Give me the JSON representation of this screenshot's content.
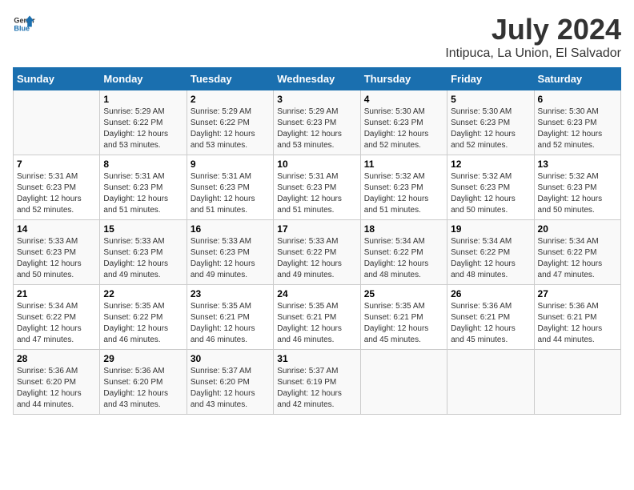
{
  "logo": {
    "general": "General",
    "blue": "Blue"
  },
  "title": "July 2024",
  "subtitle": "Intipuca, La Union, El Salvador",
  "days_header": [
    "Sunday",
    "Monday",
    "Tuesday",
    "Wednesday",
    "Thursday",
    "Friday",
    "Saturday"
  ],
  "weeks": [
    [
      {
        "day": "",
        "info": ""
      },
      {
        "day": "1",
        "info": "Sunrise: 5:29 AM\nSunset: 6:22 PM\nDaylight: 12 hours\nand 53 minutes."
      },
      {
        "day": "2",
        "info": "Sunrise: 5:29 AM\nSunset: 6:22 PM\nDaylight: 12 hours\nand 53 minutes."
      },
      {
        "day": "3",
        "info": "Sunrise: 5:29 AM\nSunset: 6:23 PM\nDaylight: 12 hours\nand 53 minutes."
      },
      {
        "day": "4",
        "info": "Sunrise: 5:30 AM\nSunset: 6:23 PM\nDaylight: 12 hours\nand 52 minutes."
      },
      {
        "day": "5",
        "info": "Sunrise: 5:30 AM\nSunset: 6:23 PM\nDaylight: 12 hours\nand 52 minutes."
      },
      {
        "day": "6",
        "info": "Sunrise: 5:30 AM\nSunset: 6:23 PM\nDaylight: 12 hours\nand 52 minutes."
      }
    ],
    [
      {
        "day": "7",
        "info": "Sunrise: 5:31 AM\nSunset: 6:23 PM\nDaylight: 12 hours\nand 52 minutes."
      },
      {
        "day": "8",
        "info": "Sunrise: 5:31 AM\nSunset: 6:23 PM\nDaylight: 12 hours\nand 51 minutes."
      },
      {
        "day": "9",
        "info": "Sunrise: 5:31 AM\nSunset: 6:23 PM\nDaylight: 12 hours\nand 51 minutes."
      },
      {
        "day": "10",
        "info": "Sunrise: 5:31 AM\nSunset: 6:23 PM\nDaylight: 12 hours\nand 51 minutes."
      },
      {
        "day": "11",
        "info": "Sunrise: 5:32 AM\nSunset: 6:23 PM\nDaylight: 12 hours\nand 51 minutes."
      },
      {
        "day": "12",
        "info": "Sunrise: 5:32 AM\nSunset: 6:23 PM\nDaylight: 12 hours\nand 50 minutes."
      },
      {
        "day": "13",
        "info": "Sunrise: 5:32 AM\nSunset: 6:23 PM\nDaylight: 12 hours\nand 50 minutes."
      }
    ],
    [
      {
        "day": "14",
        "info": "Sunrise: 5:33 AM\nSunset: 6:23 PM\nDaylight: 12 hours\nand 50 minutes."
      },
      {
        "day": "15",
        "info": "Sunrise: 5:33 AM\nSunset: 6:23 PM\nDaylight: 12 hours\nand 49 minutes."
      },
      {
        "day": "16",
        "info": "Sunrise: 5:33 AM\nSunset: 6:23 PM\nDaylight: 12 hours\nand 49 minutes."
      },
      {
        "day": "17",
        "info": "Sunrise: 5:33 AM\nSunset: 6:22 PM\nDaylight: 12 hours\nand 49 minutes."
      },
      {
        "day": "18",
        "info": "Sunrise: 5:34 AM\nSunset: 6:22 PM\nDaylight: 12 hours\nand 48 minutes."
      },
      {
        "day": "19",
        "info": "Sunrise: 5:34 AM\nSunset: 6:22 PM\nDaylight: 12 hours\nand 48 minutes."
      },
      {
        "day": "20",
        "info": "Sunrise: 5:34 AM\nSunset: 6:22 PM\nDaylight: 12 hours\nand 47 minutes."
      }
    ],
    [
      {
        "day": "21",
        "info": "Sunrise: 5:34 AM\nSunset: 6:22 PM\nDaylight: 12 hours\nand 47 minutes."
      },
      {
        "day": "22",
        "info": "Sunrise: 5:35 AM\nSunset: 6:22 PM\nDaylight: 12 hours\nand 46 minutes."
      },
      {
        "day": "23",
        "info": "Sunrise: 5:35 AM\nSunset: 6:21 PM\nDaylight: 12 hours\nand 46 minutes."
      },
      {
        "day": "24",
        "info": "Sunrise: 5:35 AM\nSunset: 6:21 PM\nDaylight: 12 hours\nand 46 minutes."
      },
      {
        "day": "25",
        "info": "Sunrise: 5:35 AM\nSunset: 6:21 PM\nDaylight: 12 hours\nand 45 minutes."
      },
      {
        "day": "26",
        "info": "Sunrise: 5:36 AM\nSunset: 6:21 PM\nDaylight: 12 hours\nand 45 minutes."
      },
      {
        "day": "27",
        "info": "Sunrise: 5:36 AM\nSunset: 6:21 PM\nDaylight: 12 hours\nand 44 minutes."
      }
    ],
    [
      {
        "day": "28",
        "info": "Sunrise: 5:36 AM\nSunset: 6:20 PM\nDaylight: 12 hours\nand 44 minutes."
      },
      {
        "day": "29",
        "info": "Sunrise: 5:36 AM\nSunset: 6:20 PM\nDaylight: 12 hours\nand 43 minutes."
      },
      {
        "day": "30",
        "info": "Sunrise: 5:37 AM\nSunset: 6:20 PM\nDaylight: 12 hours\nand 43 minutes."
      },
      {
        "day": "31",
        "info": "Sunrise: 5:37 AM\nSunset: 6:19 PM\nDaylight: 12 hours\nand 42 minutes."
      },
      {
        "day": "",
        "info": ""
      },
      {
        "day": "",
        "info": ""
      },
      {
        "day": "",
        "info": ""
      }
    ]
  ]
}
